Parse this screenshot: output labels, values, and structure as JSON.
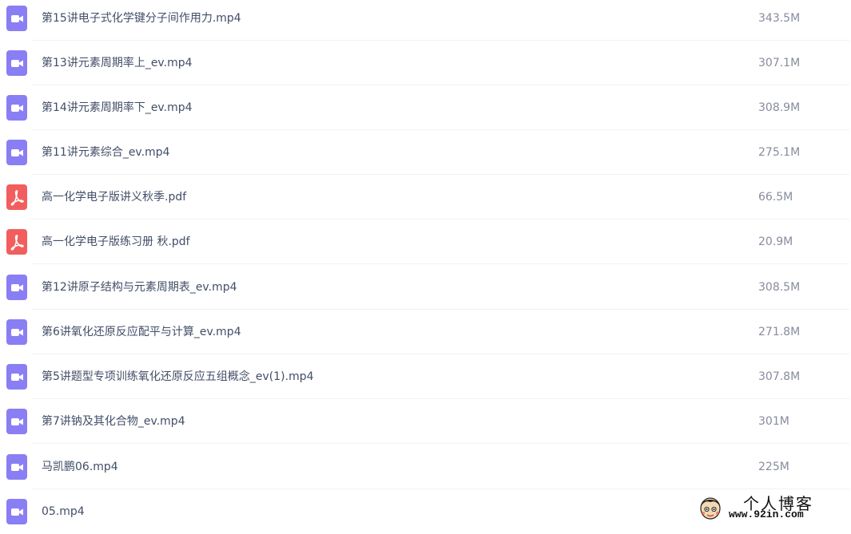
{
  "colors": {
    "video_icon": "#8a7ef4",
    "pdf_icon": "#f25e5e",
    "name_text": "#424e67",
    "size_text": "#878c9c"
  },
  "files": [
    {
      "name": "第15讲电子式化学键分子间作用力.mp4",
      "size": "343.5M",
      "type": "video",
      "icon": "video-file-icon"
    },
    {
      "name": "第13讲元素周期率上_ev.mp4",
      "size": "307.1M",
      "type": "video",
      "icon": "video-file-icon"
    },
    {
      "name": "第14讲元素周期率下_ev.mp4",
      "size": "308.9M",
      "type": "video",
      "icon": "video-file-icon"
    },
    {
      "name": "第11讲元素综合_ev.mp4",
      "size": "275.1M",
      "type": "video",
      "icon": "video-file-icon"
    },
    {
      "name": "高一化学电子版讲义秋季.pdf",
      "size": "66.5M",
      "type": "pdf",
      "icon": "pdf-file-icon"
    },
    {
      "name": "高一化学电子版练习册 秋.pdf",
      "size": "20.9M",
      "type": "pdf",
      "icon": "pdf-file-icon"
    },
    {
      "name": "第12讲原子结构与元素周期表_ev.mp4",
      "size": "308.5M",
      "type": "video",
      "icon": "video-file-icon"
    },
    {
      "name": "第6讲氧化还原反应配平与计算_ev.mp4",
      "size": "271.8M",
      "type": "video",
      "icon": "video-file-icon"
    },
    {
      "name": "第5讲题型专项训练氧化还原反应五组概念_ev(1).mp4",
      "size": "307.8M",
      "type": "video",
      "icon": "video-file-icon"
    },
    {
      "name": "第7讲钠及其化合物_ev.mp4",
      "size": "301M",
      "type": "video",
      "icon": "video-file-icon"
    },
    {
      "name": "马凯鹏06.mp4",
      "size": "225M",
      "type": "video",
      "icon": "video-file-icon"
    },
    {
      "name": "05.mp4",
      "size": "",
      "type": "video",
      "icon": "video-file-icon"
    }
  ],
  "watermark": {
    "title": "个人博客",
    "url": "www.92in.com",
    "icon": "cartoon-avatar-icon"
  }
}
